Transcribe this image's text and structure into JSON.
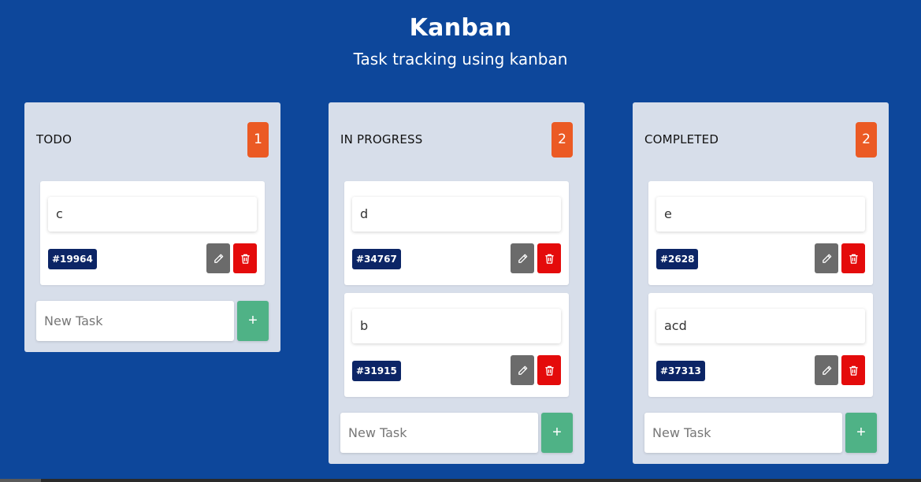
{
  "header": {
    "title": "Kanban",
    "subtitle": "Task tracking using kanban"
  },
  "colors": {
    "background": "#0d479b",
    "column": "#d7deea",
    "count_badge": "#eb5a24",
    "id_badge": "#0c2566",
    "edit_button": "#6b6b6b",
    "delete_button": "#e40b0b",
    "add_button": "#4fb286"
  },
  "icons": {
    "edit": "pencil-icon",
    "delete": "trash-icon",
    "add": "plus-icon"
  },
  "columns": [
    {
      "name": "TODO",
      "count": "1",
      "cards": [
        {
          "text": "c",
          "id": "#19964"
        }
      ],
      "new_task_placeholder": "New Task",
      "add_label": "+"
    },
    {
      "name": "IN PROGRESS",
      "count": "2",
      "cards": [
        {
          "text": "d",
          "id": "#34767"
        },
        {
          "text": "b",
          "id": "#31915"
        }
      ],
      "new_task_placeholder": "New Task",
      "add_label": "+"
    },
    {
      "name": "COMPLETED",
      "count": "2",
      "cards": [
        {
          "text": "e",
          "id": "#2628"
        },
        {
          "text": "acd",
          "id": "#37313"
        }
      ],
      "new_task_placeholder": "New Task",
      "add_label": "+"
    }
  ]
}
